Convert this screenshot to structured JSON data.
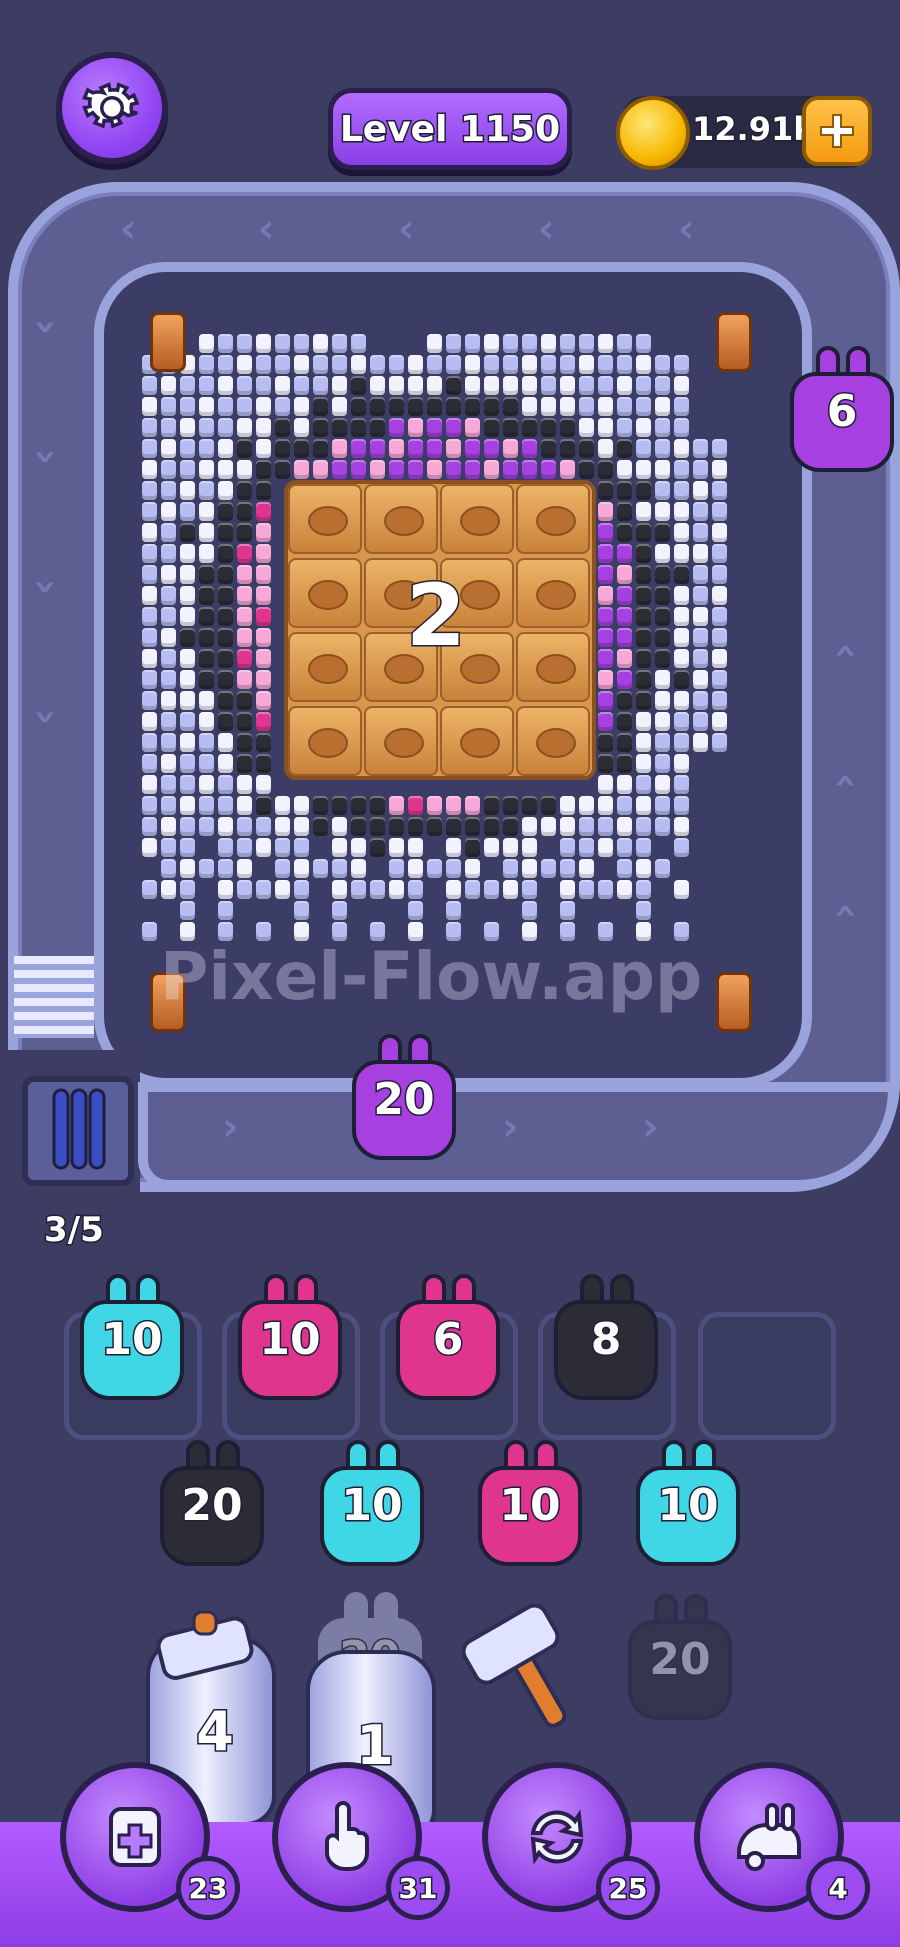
{
  "header": {
    "level_label": "Level 1150",
    "coins": "12.91k",
    "settings_icon": "gear-icon",
    "add_coins_icon": "plus-icon"
  },
  "board": {
    "crate_count": "2",
    "watermark": "Pixel-Flow.app"
  },
  "conveyor": {
    "queue_count": "3/5",
    "bunnies": [
      {
        "count": "6",
        "color": "#a640e0"
      },
      {
        "count": "20",
        "color": "#a640e0"
      }
    ]
  },
  "holding_slots": [
    {
      "count": "10",
      "color": "#3fd6e6"
    },
    {
      "count": "10",
      "color": "#e0358f"
    },
    {
      "count": "6",
      "color": "#e0358f"
    },
    {
      "count": "8",
      "color": "#2b2c35"
    },
    {
      "count": "",
      "color": ""
    }
  ],
  "queue_row": [
    {
      "count": "20",
      "color": "#2b2c35"
    },
    {
      "count": "10",
      "color": "#3fd6e6"
    },
    {
      "count": "10",
      "color": "#e0358f"
    },
    {
      "count": "10",
      "color": "#3fd6e6"
    }
  ],
  "hidden_row": [
    {
      "type": "jar",
      "count": "4"
    },
    {
      "type": "jar-bunny",
      "count": "1",
      "behind": "20"
    },
    {
      "type": "hammer",
      "count": ""
    },
    {
      "type": "bunny",
      "count": "20",
      "color": "#2b2c35"
    }
  ],
  "boosters": [
    {
      "icon": "add-slot-icon",
      "count": "23"
    },
    {
      "icon": "pointer-hand-icon",
      "count": "31"
    },
    {
      "icon": "shuffle-icon",
      "count": "25"
    },
    {
      "icon": "vacuum-icon",
      "count": "4"
    }
  ],
  "colors": {
    "purple": "#a640e0",
    "pink": "#e0358f",
    "light_pink": "#f7a8d6",
    "cyan": "#3fd6e6",
    "black": "#2b2c35",
    "lavender": "#b7bdf2",
    "white": "#f2f3ff"
  }
}
